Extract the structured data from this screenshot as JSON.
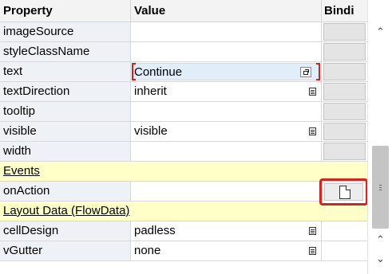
{
  "header": {
    "property": "Property",
    "value": "Value",
    "binding": "Bindi"
  },
  "rows_top": [
    {
      "property": "imageSource",
      "value": ""
    },
    {
      "property": "styleClassName",
      "value": ""
    },
    {
      "property": "text",
      "value": "Continue"
    },
    {
      "property": "textDirection",
      "value": "inherit"
    },
    {
      "property": "tooltip",
      "value": ""
    },
    {
      "property": "visible",
      "value": "visible"
    },
    {
      "property": "width",
      "value": ""
    }
  ],
  "sections": {
    "events": "Events",
    "layout_data": "Layout Data (FlowData)"
  },
  "rows_events": [
    {
      "property": "onAction",
      "value": ""
    }
  ],
  "rows_layout": [
    {
      "property": "cellDesign",
      "value": "padless"
    },
    {
      "property": "vGutter",
      "value": "none"
    }
  ],
  "icons": {
    "value_help": "value-help-icon",
    "expand_editor": "expand-editor-icon",
    "binding_document": "document-icon",
    "scroll_up": "chevron-up-icon",
    "scroll_down": "chevron-down-icon"
  },
  "colors": {
    "section_bg": "#ffffc8",
    "edit_bg": "#e1eefa",
    "highlight": "#e02020"
  }
}
